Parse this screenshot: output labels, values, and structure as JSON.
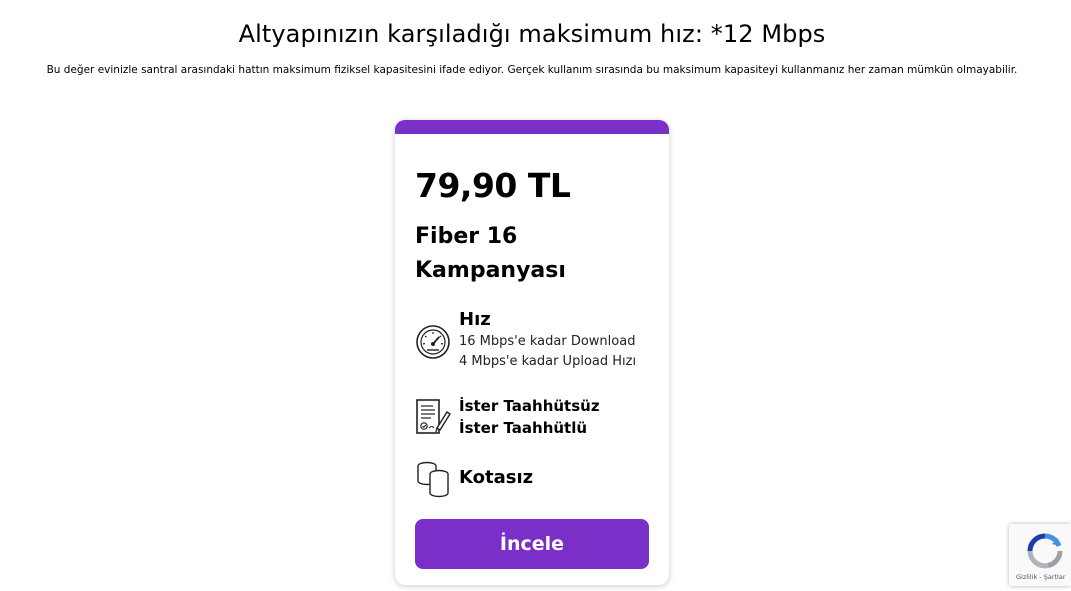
{
  "header": {
    "title": "Altyapınızın karşıladığı maksimum hız: *12 Mbps",
    "description": "Bu değer evinizle santral arasındaki hattın maksimum fiziksel kapasitesini ifade ediyor. Gerçek kullanım sırasında bu maksimum kapasiteyi kullanmanız her zaman mümkün olmayabilir."
  },
  "card": {
    "accent_color": "#7b2fc9",
    "price": "79,90 TL",
    "plan_name": "Fiber 16 Kampanyası",
    "features": [
      {
        "icon": "speedometer-icon",
        "title": "Hız",
        "lines": [
          "16 Mbps'e kadar Download",
          "4 Mbps'e kadar Upload Hızı"
        ]
      },
      {
        "icon": "contract-icon",
        "lines": [
          "İster Taahhütsüz",
          "İster Taahhütlü"
        ]
      },
      {
        "icon": "coins-icon",
        "title": "Kotasız"
      }
    ],
    "button_label": "İncele"
  },
  "recaptcha": {
    "links": "Gizlilik - Şartlar"
  }
}
